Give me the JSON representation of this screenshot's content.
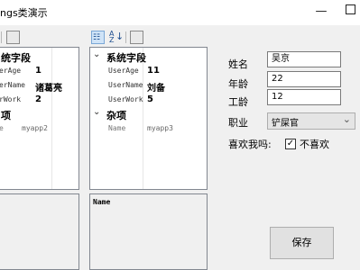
{
  "window": {
    "title": "ngs类演示",
    "minimize_glyph": "—"
  },
  "left_grid": {
    "categories": [
      {
        "label": "统字段",
        "properties": [
          {
            "name": "erAge",
            "value": "1"
          },
          {
            "name": "erName",
            "value": "诸葛亮"
          },
          {
            "name": "rWork",
            "value": "2"
          }
        ]
      },
      {
        "label": "项",
        "properties": [
          {
            "name": "e",
            "value": "myapp2"
          }
        ]
      }
    ],
    "description_title": ""
  },
  "right_grid": {
    "categories": [
      {
        "label": "系统字段",
        "properties": [
          {
            "name": "UserAge",
            "value": "11"
          },
          {
            "name": "UserName",
            "value": "刘备"
          },
          {
            "name": "UserWork",
            "value": "5"
          }
        ]
      },
      {
        "label": "杂项",
        "properties": [
          {
            "name": "Name",
            "value": "myapp3"
          }
        ]
      }
    ],
    "description_title": "Name"
  },
  "form": {
    "name_label": "姓名",
    "name_value": "吴京",
    "age_label": "年龄",
    "age_value": "22",
    "work_label": "工龄",
    "work_value": "12",
    "job_label": "职业",
    "job_value": "铲屎官",
    "like_label": "喜欢我吗:",
    "like_checkbox_label": "不喜欢",
    "like_checked": true,
    "save_label": "保存"
  }
}
